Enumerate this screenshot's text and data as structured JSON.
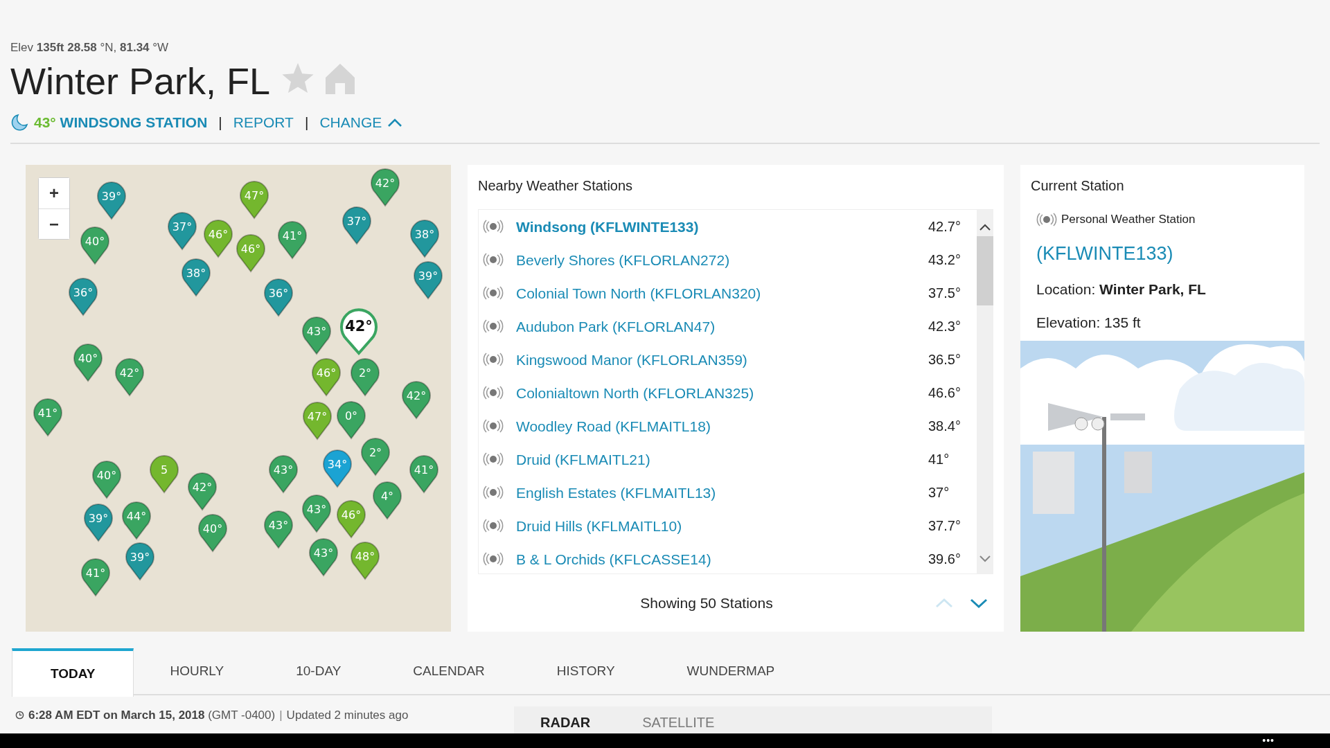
{
  "header": {
    "elevation_label": "Elev",
    "elevation": "135ft",
    "latitude": "28.58",
    "lat_unit": "°N,",
    "longitude": "81.34",
    "lon_unit": "°W",
    "title": "Winter Park, FL",
    "favorite": false,
    "home": false,
    "current_temp": "43°",
    "station_name": "WINDSONG STATION",
    "separator_1": "|",
    "report_link": "REPORT",
    "separator_2": "|",
    "change_link": "CHANGE",
    "change_expanded": true
  },
  "map": {
    "zoom_in": "+",
    "zoom_out": "−",
    "pins": [
      {
        "temp": "39°",
        "color": "#22979d",
        "selected": false
      },
      {
        "temp": "47°",
        "color": "#74b72e",
        "selected": false
      },
      {
        "temp": "42°",
        "color": "#3aa561",
        "selected": false
      },
      {
        "temp": "40°",
        "color": "#3aa561",
        "selected": false
      },
      {
        "temp": "37°",
        "color": "#22979d",
        "selected": false
      },
      {
        "temp": "46°",
        "color": "#74b72e",
        "selected": false
      },
      {
        "temp": "46°",
        "color": "#74b72e",
        "selected": false
      },
      {
        "temp": "41°",
        "color": "#3aa561",
        "selected": false
      },
      {
        "temp": "37°",
        "color": "#22979d",
        "selected": false
      },
      {
        "temp": "38°",
        "color": "#22979d",
        "selected": false
      },
      {
        "temp": "36°",
        "color": "#22979d",
        "selected": false
      },
      {
        "temp": "38°",
        "color": "#22979d",
        "selected": false
      },
      {
        "temp": "36°",
        "color": "#22979d",
        "selected": false
      },
      {
        "temp": "39°",
        "color": "#22979d",
        "selected": false
      },
      {
        "temp": "43°",
        "color": "#3aa561",
        "selected": false
      },
      {
        "temp": "42°",
        "color": "#3aa561",
        "selected": true
      },
      {
        "temp": "40°",
        "color": "#3aa561",
        "selected": false
      },
      {
        "temp": "42°",
        "color": "#3aa561",
        "selected": false
      },
      {
        "temp": "46°",
        "color": "#74b72e",
        "selected": false
      },
      {
        "temp": "2°",
        "color": "#3aa561",
        "selected": false
      },
      {
        "temp": "41°",
        "color": "#3aa561",
        "selected": false
      },
      {
        "temp": "47°",
        "color": "#74b72e",
        "selected": false
      },
      {
        "temp": "0°",
        "color": "#3aa561",
        "selected": false
      },
      {
        "temp": "42°",
        "color": "#3aa561",
        "selected": false
      },
      {
        "temp": "40°",
        "color": "#3aa561",
        "selected": false
      },
      {
        "temp": "5",
        "color": "#74b72e",
        "selected": false
      },
      {
        "temp": "43°",
        "color": "#3aa561",
        "selected": false
      },
      {
        "temp": "34°",
        "color": "#1ba3d3",
        "selected": false
      },
      {
        "temp": "2°",
        "color": "#3aa561",
        "selected": false
      },
      {
        "temp": "41°",
        "color": "#3aa561",
        "selected": false
      },
      {
        "temp": "39°",
        "color": "#22979d",
        "selected": false
      },
      {
        "temp": "44°",
        "color": "#3aa561",
        "selected": false
      },
      {
        "temp": "42°",
        "color": "#3aa561",
        "selected": false
      },
      {
        "temp": "40°",
        "color": "#3aa561",
        "selected": false
      },
      {
        "temp": "43°",
        "color": "#3aa561",
        "selected": false
      },
      {
        "temp": "43°",
        "color": "#3aa561",
        "selected": false
      },
      {
        "temp": "46°",
        "color": "#74b72e",
        "selected": false
      },
      {
        "temp": "4°",
        "color": "#3aa561",
        "selected": false
      },
      {
        "temp": "41°",
        "color": "#3aa561",
        "selected": false
      },
      {
        "temp": "39°",
        "color": "#22979d",
        "selected": false
      },
      {
        "temp": "43°",
        "color": "#3aa561",
        "selected": false
      },
      {
        "temp": "48°",
        "color": "#74b72e",
        "selected": false
      }
    ]
  },
  "nearby": {
    "title": "Nearby Weather Stations",
    "stations": [
      {
        "name": "Windsong (KFLWINTE133)",
        "temp": "42.7°",
        "selected": true
      },
      {
        "name": "Beverly Shores (KFLORLAN272)",
        "temp": "43.2°",
        "selected": false
      },
      {
        "name": "Colonial Town North (KFLORLAN320)",
        "temp": "37.5°",
        "selected": false
      },
      {
        "name": "Audubon Park (KFLORLAN47)",
        "temp": "42.3°",
        "selected": false
      },
      {
        "name": "Kingswood Manor (KFLORLAN359)",
        "temp": "36.5°",
        "selected": false
      },
      {
        "name": "Colonialtown North (KFLORLAN325)",
        "temp": "46.6°",
        "selected": false
      },
      {
        "name": "Woodley Road (KFLMAITL18)",
        "temp": "38.4°",
        "selected": false
      },
      {
        "name": "Druid (KFLMAITL21)",
        "temp": "41°",
        "selected": false
      },
      {
        "name": "English Estates (KFLMAITL13)",
        "temp": "37°",
        "selected": false
      },
      {
        "name": "Druid Hills (KFLMAITL10)",
        "temp": "37.7°",
        "selected": false
      },
      {
        "name": "B & L Orchids (KFLCASSE14)",
        "temp": "39.6°",
        "selected": false
      }
    ],
    "footer": "Showing 50 Stations",
    "prev_disabled": true,
    "next_disabled": false
  },
  "current_station": {
    "title": "Current Station",
    "type": "Personal Weather Station",
    "station_id": "(KFLWINTE133)",
    "location_label": "Location:",
    "location": "Winter Park, FL",
    "elevation": "Elevation: 135 ft"
  },
  "tabs": [
    {
      "label": "TODAY",
      "selected": true
    },
    {
      "label": "HOURLY",
      "selected": false
    },
    {
      "label": "10-DAY",
      "selected": false
    },
    {
      "label": "CALENDAR",
      "selected": false
    },
    {
      "label": "HISTORY",
      "selected": false
    },
    {
      "label": "WUNDERMAP",
      "selected": false
    }
  ],
  "status": {
    "time": "**6:28 AM EDT on March 15, 2018** (GMT -0400)",
    "separator": "|",
    "updated": "Updated 2 minutes ago"
  },
  "map_tabs": [
    {
      "label": "RADAR",
      "selected": true
    },
    {
      "label": "SATELLITE",
      "selected": false
    }
  ],
  "bottom_bar": {
    "menu": "•••"
  }
}
